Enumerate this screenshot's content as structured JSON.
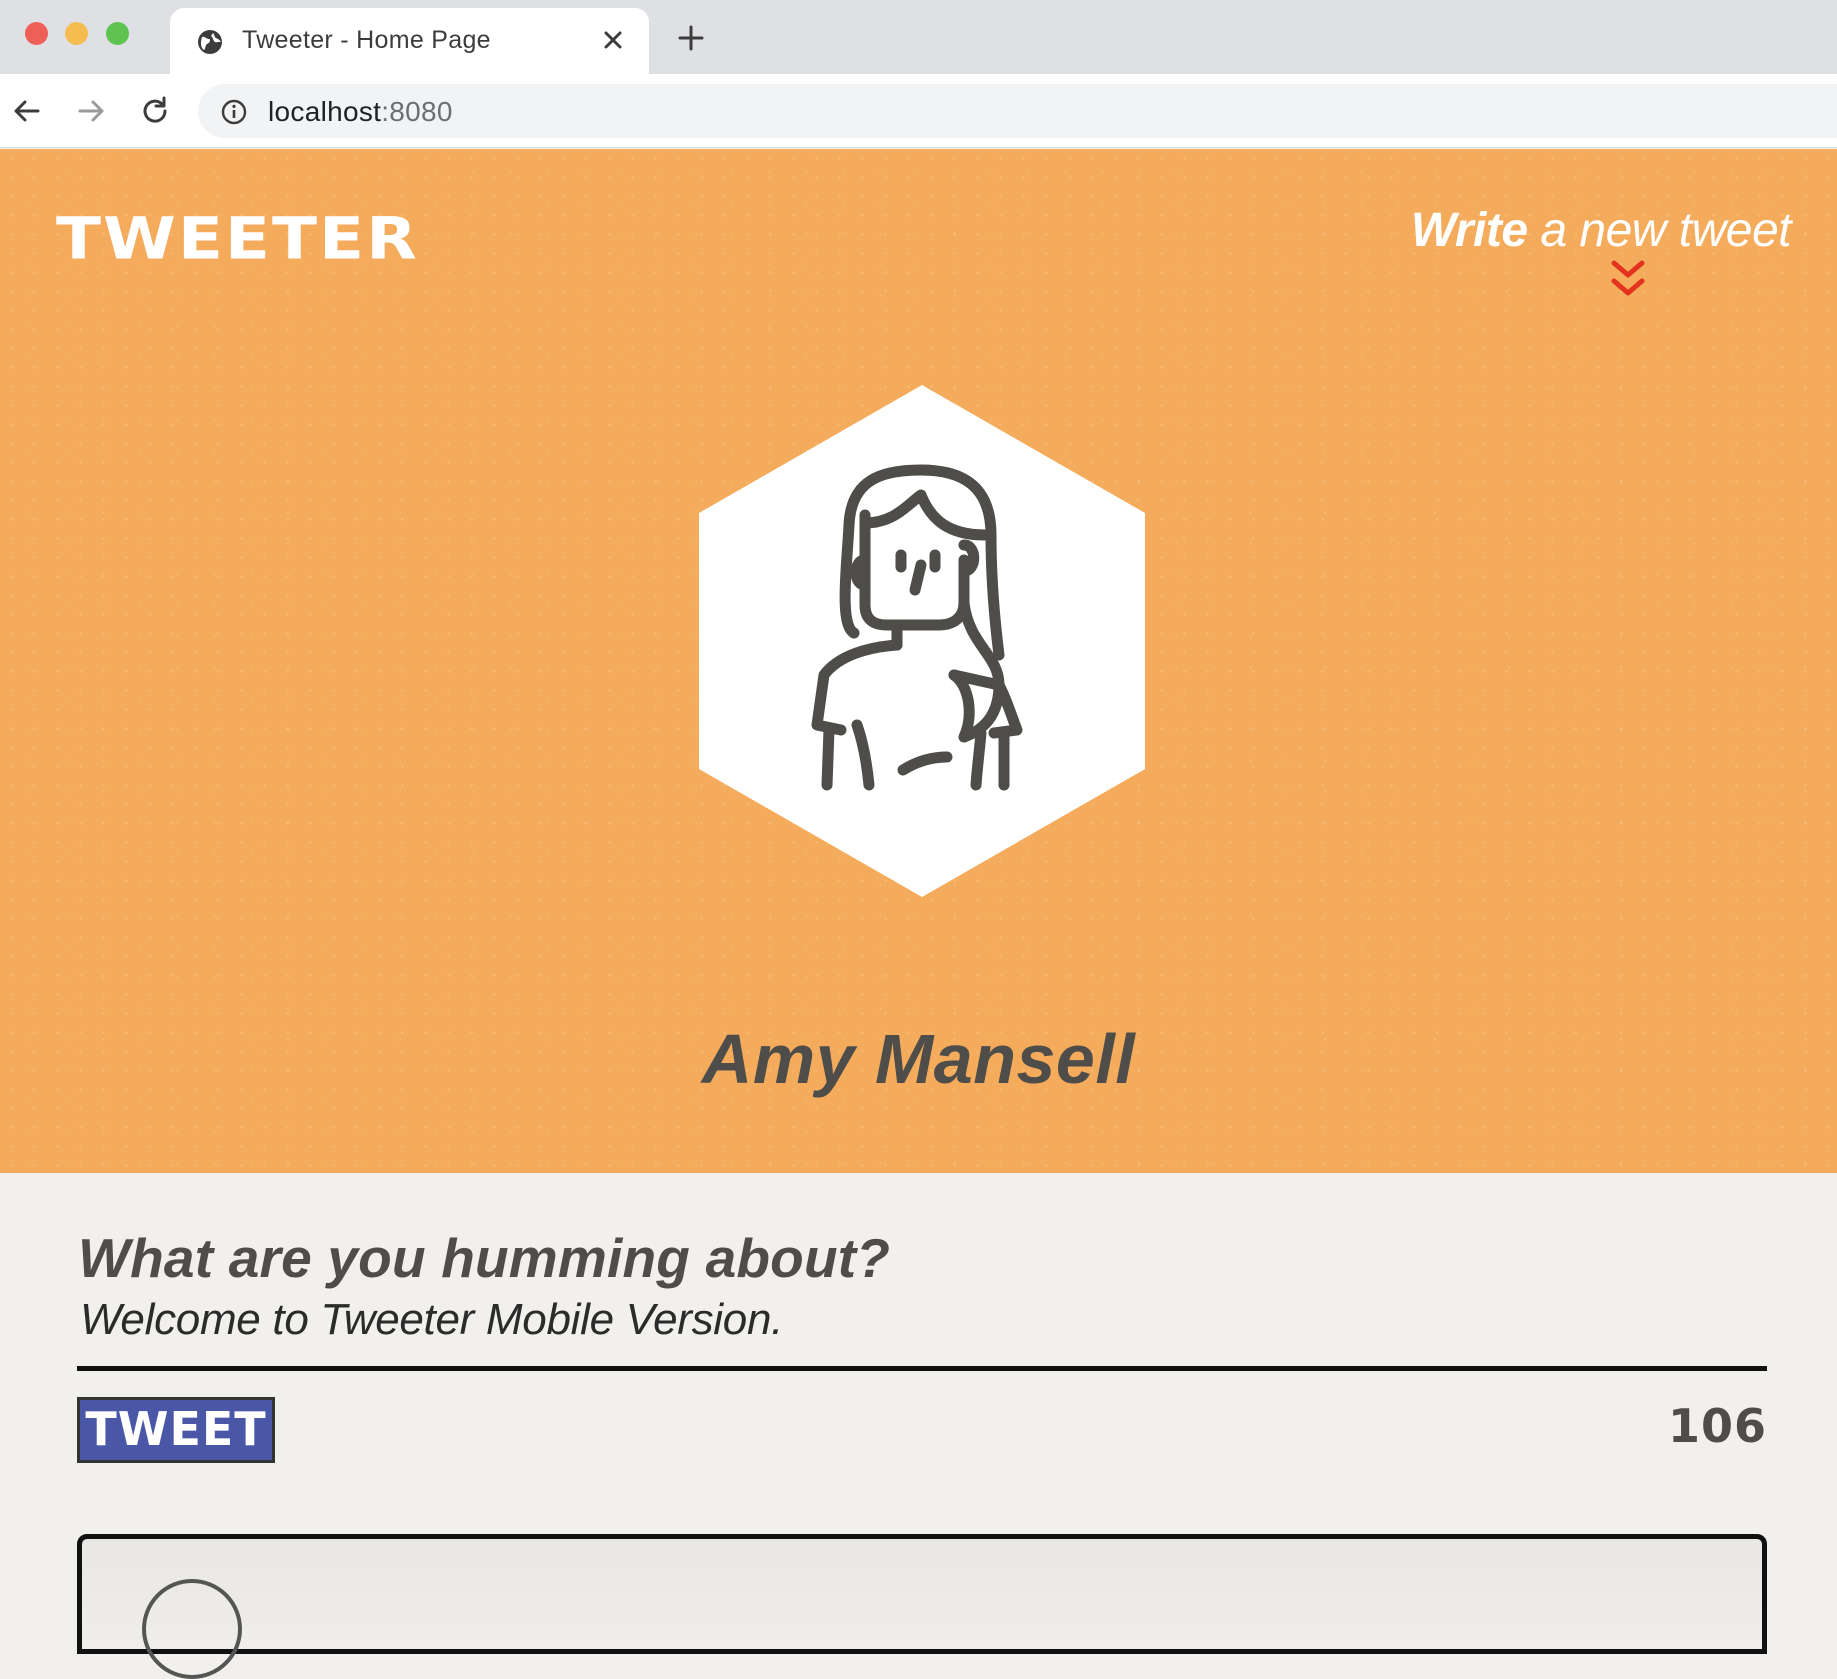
{
  "browser": {
    "tab_title": "Tweeter - Home Page",
    "url_host": "localhost",
    "url_port": ":8080"
  },
  "header": {
    "brand": "TWEETER",
    "write_strong": "Write",
    "write_rest": " a new tweet"
  },
  "profile": {
    "name": "Amy Mansell"
  },
  "compose": {
    "prompt": "What are you humming about?",
    "welcome": "Welcome to Tweeter Mobile Version.",
    "tweet_button": "TWEET",
    "counter": "106"
  },
  "colors": {
    "hero_bg": "#f4ab5b",
    "compose_bg": "#f2f0ec",
    "button_bg": "#4a57a6",
    "chevron": "#e5321e",
    "text_dark": "#4f4d4a"
  }
}
